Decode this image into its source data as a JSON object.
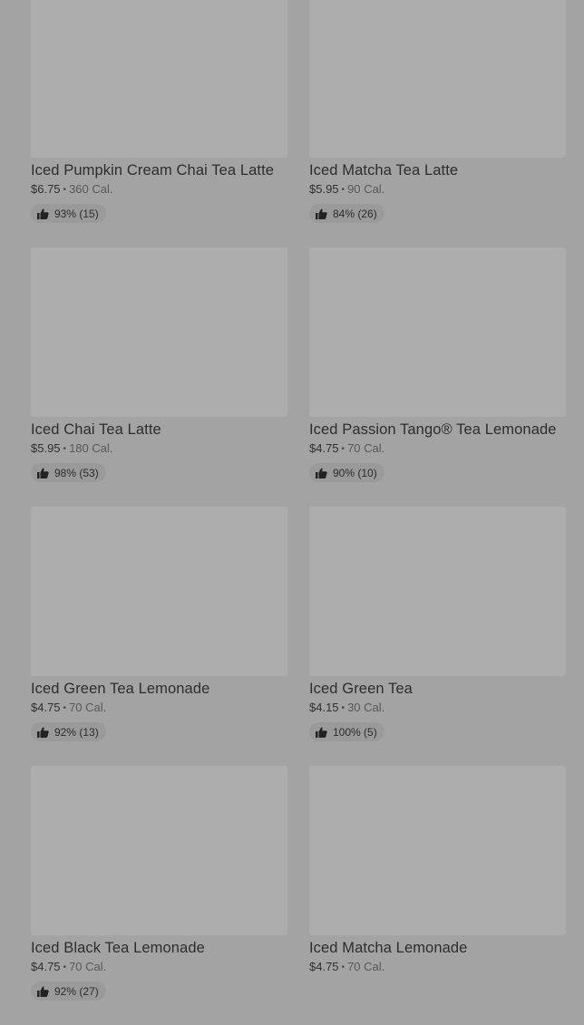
{
  "items": [
    {
      "name": "Iced Pumpkin Cream Chai Tea Latte",
      "price": "$6.75",
      "separator": "•",
      "calories": "360 Cal.",
      "rating": "93% (15)"
    },
    {
      "name": "Iced Matcha Tea Latte",
      "price": "$5.95",
      "separator": "•",
      "calories": "90 Cal.",
      "rating": "84% (26)"
    },
    {
      "name": "Iced Chai Tea Latte",
      "price": "$5.95",
      "separator": "•",
      "calories": "180 Cal.",
      "rating": "98% (53)"
    },
    {
      "name": "Iced Passion Tango® Tea Lemonade",
      "price": "$4.75",
      "separator": "•",
      "calories": "70 Cal.",
      "rating": "90% (10)"
    },
    {
      "name": "Iced Green Tea Lemonade",
      "price": "$4.75",
      "separator": "•",
      "calories": "70 Cal.",
      "rating": "92% (13)"
    },
    {
      "name": "Iced Green Tea",
      "price": "$4.15",
      "separator": "•",
      "calories": "30 Cal.",
      "rating": "100% (5)"
    },
    {
      "name": "Iced Black Tea Lemonade",
      "price": "$4.75",
      "separator": "•",
      "calories": "70 Cal.",
      "rating": "92% (27)"
    },
    {
      "name": "Iced Matcha Lemonade",
      "price": "$4.75",
      "separator": "•",
      "calories": "70 Cal.",
      "rating": null
    }
  ],
  "icons": {
    "rating": "thumbs-up-icon"
  },
  "colors": {
    "overlay_background": "#a3a3a3",
    "thumbnail_placeholder": "#adadad",
    "rating_pill": "#9a9a9a"
  }
}
